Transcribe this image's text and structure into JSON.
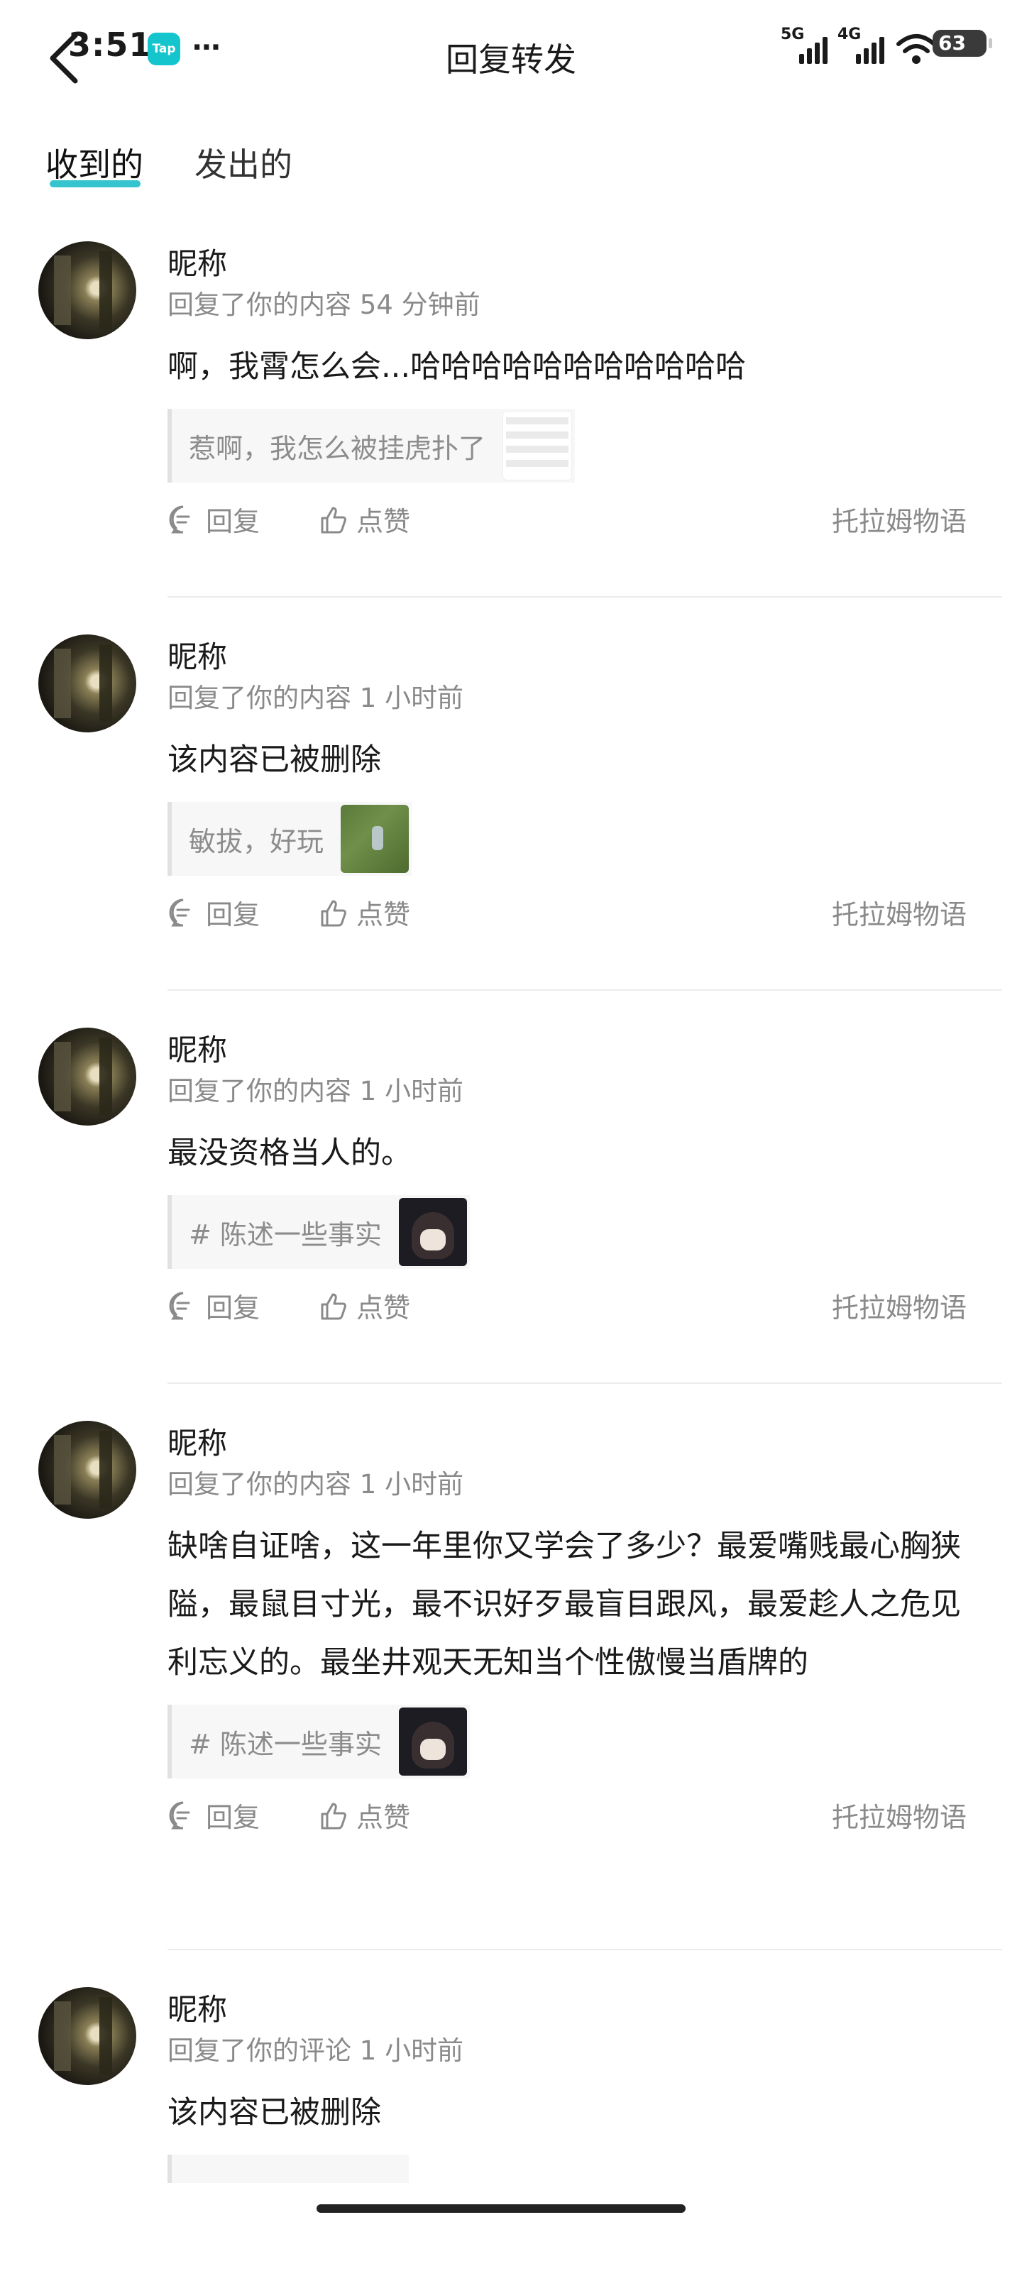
{
  "status_bar": {
    "time": "3:51",
    "app_badge": "Tap",
    "more": "···",
    "net1": "5G",
    "net2": "4G",
    "battery": "63"
  },
  "header": {
    "title": "回复转发",
    "back_icon": "chevron-left-icon"
  },
  "tabs": [
    {
      "label": "收到的",
      "active": true
    },
    {
      "label": "发出的",
      "active": false
    }
  ],
  "accent": "#36c5cf",
  "items": [
    {
      "nickname": "昵称",
      "meta": "回复了你的内容 54 分钟前",
      "content": "啊，我霄怎么会...哈哈哈哈哈哈哈哈哈哈哈",
      "quote": "惹啊，我怎么被挂虎扑了",
      "thumb": "screenshot-thumbnail",
      "reply": "回复",
      "like": "点赞",
      "source": "托拉姆物语"
    },
    {
      "nickname": "昵称",
      "meta": "回复了你的内容 1 小时前",
      "content": "该内容已被删除",
      "quote": "敏拔，好玩",
      "thumb": "game-thumbnail",
      "reply": "回复",
      "like": "点赞",
      "source": "托拉姆物语"
    },
    {
      "nickname": "昵称",
      "meta": "回复了你的内容 1 小时前",
      "content": "最没资格当人的。",
      "quote": "# 陈述一些事实",
      "thumb": "anime-avatar-thumbnail",
      "reply": "回复",
      "like": "点赞",
      "source": "托拉姆物语"
    },
    {
      "nickname": "昵称",
      "meta": "回复了你的内容 1 小时前",
      "content": "缺啥自证啥，这一年里你又学会了多少？最爱嘴贱最心胸狭隘，最鼠目寸光，最不识好歹最盲目跟风，最爱趁人之危见利忘义的。最坐井观天无知当个性傲慢当盾牌的",
      "quote": "# 陈述一些事实",
      "thumb": "anime-avatar-thumbnail",
      "reply": "回复",
      "like": "点赞",
      "source": "托拉姆物语"
    },
    {
      "nickname": "昵称",
      "meta": "回复了你的评论 1 小时前",
      "content": "该内容已被删除"
    }
  ]
}
